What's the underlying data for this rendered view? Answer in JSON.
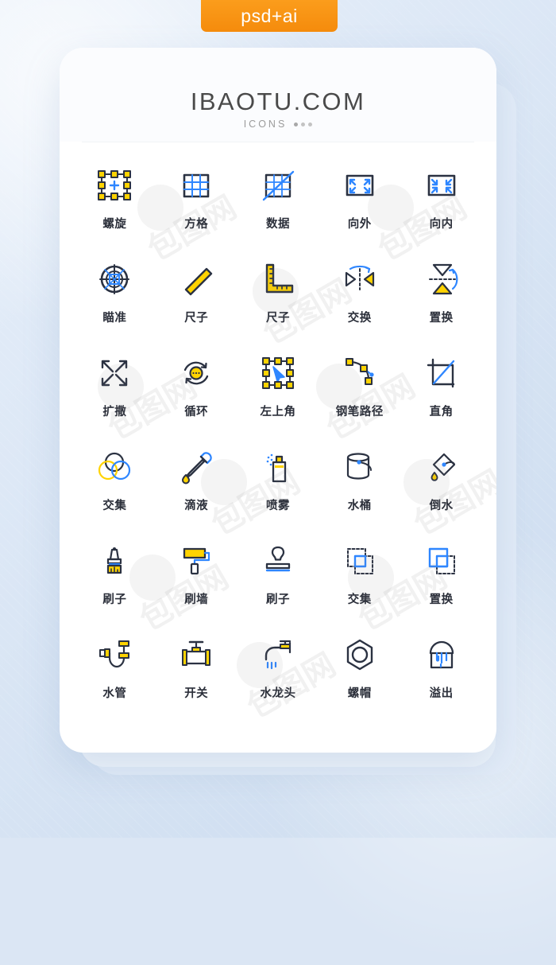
{
  "tag": {
    "label": "psd+ai",
    "color": "#f58b0c"
  },
  "header": {
    "title": "IBAOTU.COM",
    "subtitle": "ICONS",
    "dots": 3
  },
  "theme": {
    "line": "#2b3242",
    "yellow": "#ffd300",
    "blue": "#2e86ff",
    "card_bg": "#ffffff",
    "page_bg": "#dbe6f4",
    "label_color": "#2b2f3a"
  },
  "watermark": {
    "text": "包图网",
    "mark": "6"
  },
  "icons": [
    {
      "name": "螺旋",
      "icon": "transform-handles-icon",
      "row": 1,
      "col": 1
    },
    {
      "name": "方格",
      "icon": "grid-square-icon",
      "row": 1,
      "col": 2
    },
    {
      "name": "数据",
      "icon": "grid-diagonal-icon",
      "row": 1,
      "col": 3
    },
    {
      "name": "向外",
      "icon": "expand-outward-icon",
      "row": 1,
      "col": 4
    },
    {
      "name": "向内",
      "icon": "collapse-inward-icon",
      "row": 1,
      "col": 5
    },
    {
      "name": "瞄准",
      "icon": "crosshair-target-icon",
      "row": 2,
      "col": 1
    },
    {
      "name": "尺子",
      "icon": "ruler-diagonal-icon",
      "row": 2,
      "col": 2
    },
    {
      "name": "尺子",
      "icon": "ruler-lshape-icon",
      "row": 2,
      "col": 3
    },
    {
      "name": "交换",
      "icon": "swap-horizontal-icon",
      "row": 2,
      "col": 4
    },
    {
      "name": "置换",
      "icon": "swap-vertical-icon",
      "row": 2,
      "col": 5
    },
    {
      "name": "扩撒",
      "icon": "four-arrows-expand-icon",
      "row": 3,
      "col": 1
    },
    {
      "name": "循环",
      "icon": "loop-refresh-icon",
      "row": 3,
      "col": 2
    },
    {
      "name": "左上角",
      "icon": "cursor-selection-icon",
      "row": 3,
      "col": 3
    },
    {
      "name": "钢笔路径",
      "icon": "pen-path-icon",
      "row": 3,
      "col": 4
    },
    {
      "name": "直角",
      "icon": "crop-right-angle-icon",
      "row": 3,
      "col": 5
    },
    {
      "name": "交集",
      "icon": "venn-circles-icon",
      "row": 4,
      "col": 1
    },
    {
      "name": "滴液",
      "icon": "eyedropper-icon",
      "row": 4,
      "col": 2
    },
    {
      "name": "喷雾",
      "icon": "spray-can-icon",
      "row": 4,
      "col": 3
    },
    {
      "name": "水桶",
      "icon": "paint-bucket-icon",
      "row": 4,
      "col": 4
    },
    {
      "name": "倒水",
      "icon": "pour-bucket-icon",
      "row": 4,
      "col": 5
    },
    {
      "name": "刷子",
      "icon": "paint-brush-icon",
      "row": 5,
      "col": 1
    },
    {
      "name": "刷墙",
      "icon": "paint-roller-icon",
      "row": 5,
      "col": 2
    },
    {
      "name": "刷子",
      "icon": "stamp-brush-icon",
      "row": 5,
      "col": 3
    },
    {
      "name": "交集",
      "icon": "intersect-squares-icon",
      "row": 5,
      "col": 4
    },
    {
      "name": "置换",
      "icon": "replace-squares-icon",
      "row": 5,
      "col": 5
    },
    {
      "name": "水管",
      "icon": "pipe-trap-icon",
      "row": 6,
      "col": 1
    },
    {
      "name": "开关",
      "icon": "valve-switch-icon",
      "row": 6,
      "col": 2
    },
    {
      "name": "水龙头",
      "icon": "faucet-icon",
      "row": 6,
      "col": 3
    },
    {
      "name": "螺帽",
      "icon": "hex-nut-icon",
      "row": 6,
      "col": 4
    },
    {
      "name": "溢出",
      "icon": "overflow-bucket-icon",
      "row": 6,
      "col": 5
    }
  ]
}
